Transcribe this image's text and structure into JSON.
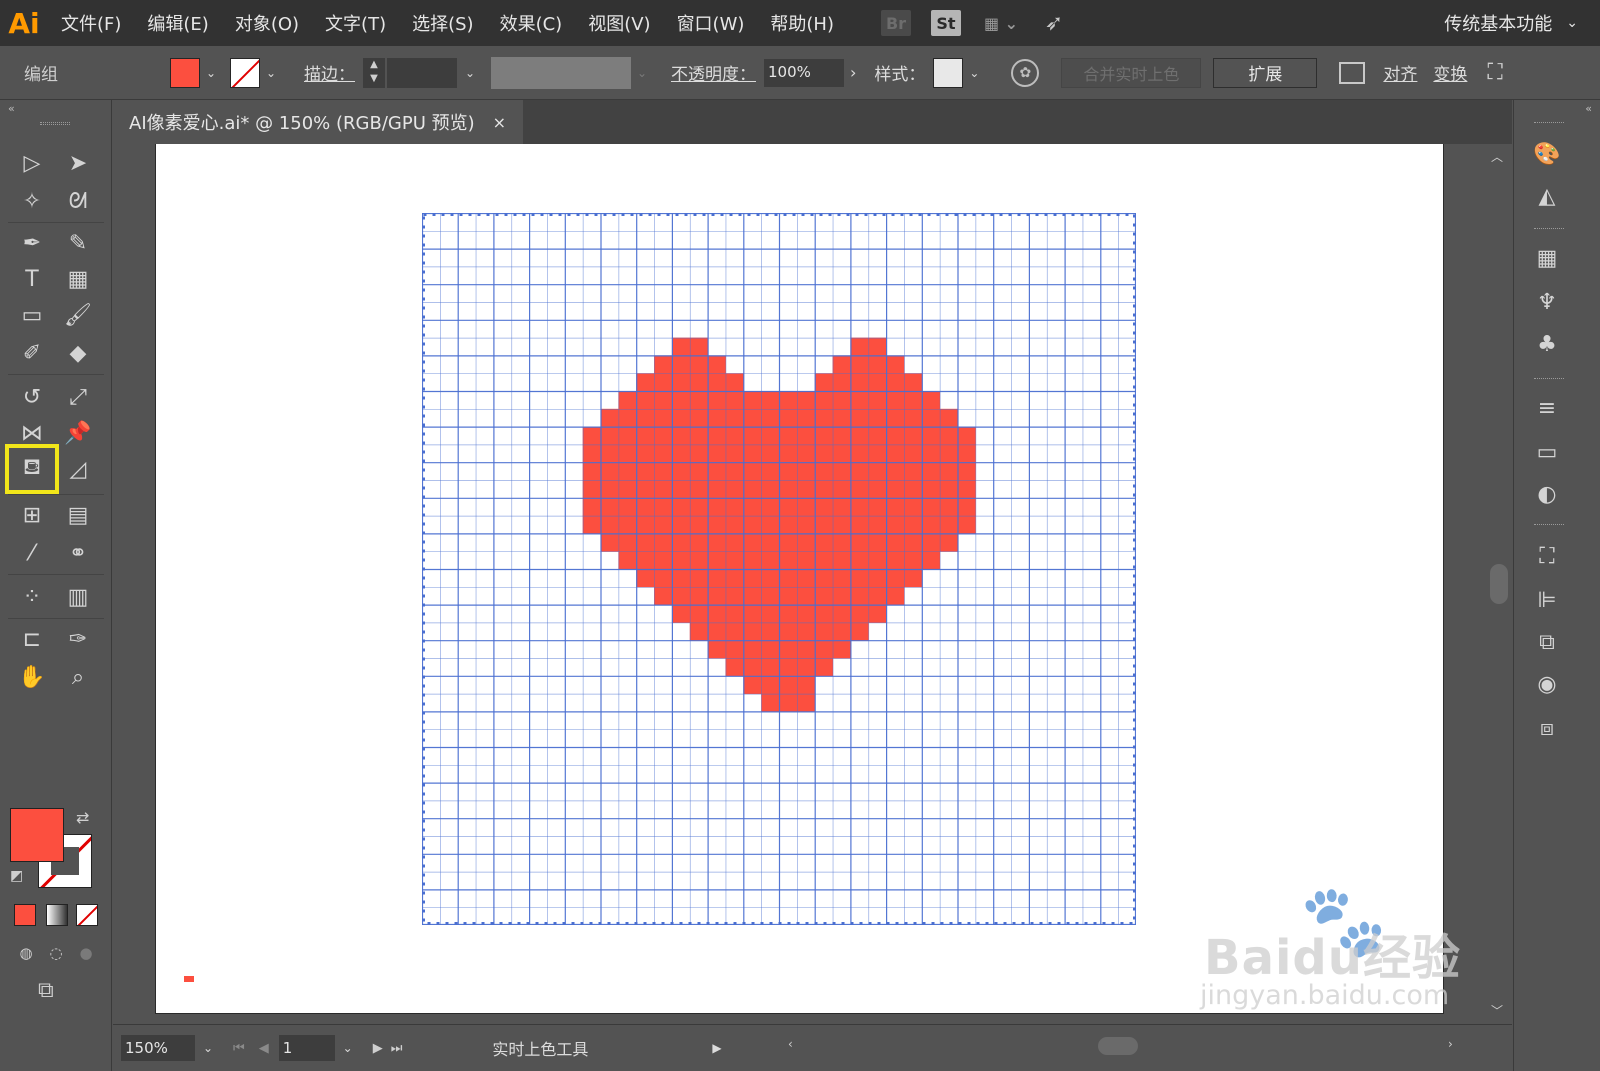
{
  "app": {
    "logo_text": "Ai",
    "menus": [
      "文件(F)",
      "编辑(E)",
      "对象(O)",
      "文字(T)",
      "选择(S)",
      "效果(C)",
      "视图(V)",
      "窗口(W)",
      "帮助(H)"
    ],
    "bridge_label": "Br",
    "stock_label": "St",
    "workspace": "传统基本功能"
  },
  "control_bar": {
    "selection_type": "编组",
    "fill_color": "#fc4f3f",
    "stroke_label": "描边：",
    "opacity_label": "不透明度：",
    "opacity_value": "100%",
    "style_label": "样式：",
    "merge_button": "合并实时上色",
    "expand_button": "扩展",
    "align_link": "对齐",
    "transform_link": "变换"
  },
  "document": {
    "tab_title": "AI像素爱心.ai* @ 150% (RGB/GPU 预览)",
    "close_glyph": "×"
  },
  "canvas": {
    "grid_columns": 40,
    "grid_rows": 40,
    "grid_line_color": "#4a6fd1",
    "heart_color": "#fc4f3f",
    "heart_rows": [
      {
        "row": 7,
        "cols": [
          [
            14,
            16
          ],
          [
            24,
            26
          ]
        ]
      },
      {
        "row": 8,
        "cols": [
          [
            13,
            17
          ],
          [
            23,
            27
          ]
        ]
      },
      {
        "row": 9,
        "cols": [
          [
            12,
            18
          ],
          [
            22,
            28
          ]
        ]
      },
      {
        "row": 10,
        "cols": [
          [
            11,
            29
          ]
        ]
      },
      {
        "row": 11,
        "cols": [
          [
            10,
            30
          ]
        ]
      },
      {
        "row": 12,
        "cols": [
          [
            9,
            31
          ]
        ]
      },
      {
        "row": 13,
        "cols": [
          [
            9,
            31
          ]
        ]
      },
      {
        "row": 14,
        "cols": [
          [
            9,
            31
          ]
        ]
      },
      {
        "row": 15,
        "cols": [
          [
            9,
            31
          ]
        ]
      },
      {
        "row": 16,
        "cols": [
          [
            9,
            31
          ]
        ]
      },
      {
        "row": 17,
        "cols": [
          [
            9,
            31
          ]
        ]
      },
      {
        "row": 18,
        "cols": [
          [
            10,
            30
          ]
        ]
      },
      {
        "row": 19,
        "cols": [
          [
            11,
            29
          ]
        ]
      },
      {
        "row": 20,
        "cols": [
          [
            12,
            28
          ]
        ]
      },
      {
        "row": 21,
        "cols": [
          [
            13,
            27
          ]
        ]
      },
      {
        "row": 22,
        "cols": [
          [
            14,
            26
          ]
        ]
      },
      {
        "row": 23,
        "cols": [
          [
            15,
            25
          ]
        ]
      },
      {
        "row": 24,
        "cols": [
          [
            16,
            24
          ]
        ]
      },
      {
        "row": 25,
        "cols": [
          [
            17,
            23
          ]
        ]
      },
      {
        "row": 26,
        "cols": [
          [
            18,
            22
          ]
        ]
      },
      {
        "row": 27,
        "cols": [
          [
            19,
            22
          ]
        ]
      }
    ]
  },
  "tools": {
    "fill_color": "#fc4f3f",
    "highlight_color": "#f2e61a",
    "active_tool": "live-paint-bucket"
  },
  "status_bar": {
    "zoom": "150%",
    "artboard_number": "1",
    "status_text": "实时上色工具"
  },
  "watermark": {
    "logo": "Baidu经验",
    "url": "jingyan.baidu.com"
  }
}
